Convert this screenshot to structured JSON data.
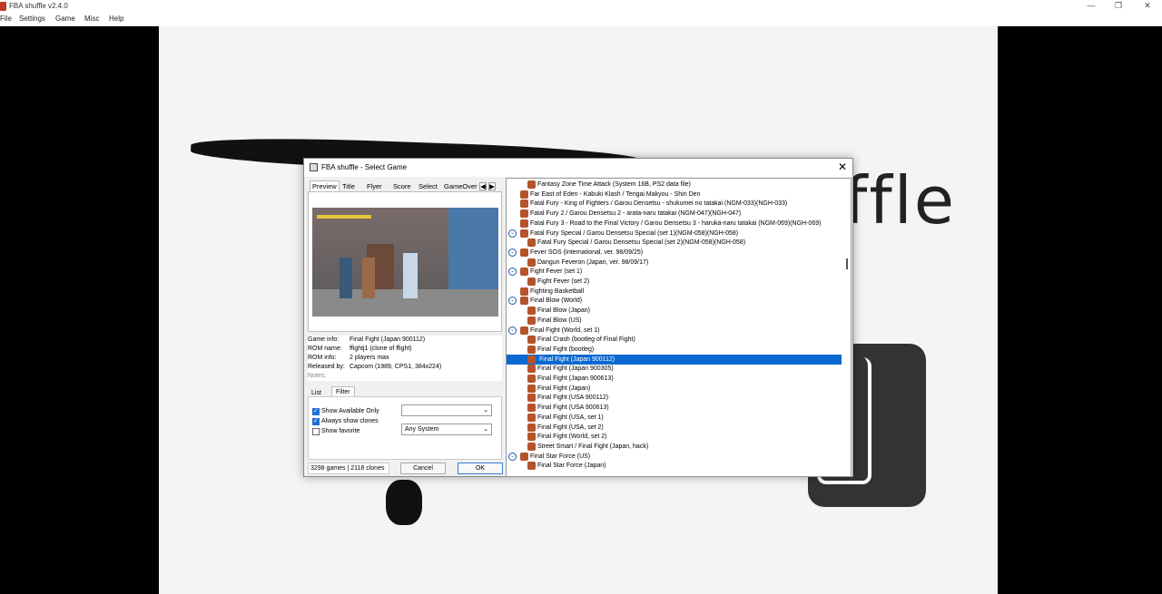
{
  "app": {
    "title": "FBA shuffle v2.4.0"
  },
  "window_controls": {
    "minimize": "—",
    "restore": "❐",
    "close": "✕"
  },
  "menu": [
    "File",
    "Settings",
    "Game",
    "Misc",
    "Help"
  ],
  "background": {
    "logo_text": "ffle"
  },
  "dialog": {
    "title": "FBA shuffle - Select Game",
    "close": "✕",
    "tabs": [
      "Preview",
      "Title",
      "Flyer",
      "Score",
      "Select",
      "GameOver"
    ],
    "tab_left": "◀",
    "tab_right": "▶",
    "info": {
      "game_info_label": "Game info:",
      "game_info_value": "Final Fight (Japan 900112)",
      "rom_name_label": "ROM name:",
      "rom_name_value": "ffightj1 (clone of ffight)",
      "rom_info_label": "ROM info:",
      "rom_info_value": "2 players max",
      "released_label": "Released by:",
      "released_value": "Capcom (1989, CPS1, 384x224)",
      "notes_label": "Notes:"
    },
    "filter_tabs": [
      "List",
      "Filter"
    ],
    "filter": {
      "show_available": "Show Available Only",
      "always_show_clones": "Always show clones",
      "show_favorite": "Show favorite",
      "combo1": "",
      "combo2": "Any System",
      "show_available_checked": true,
      "always_show_clones_checked": true,
      "show_favorite_checked": false
    },
    "count": "3298 games | 2118 clones",
    "cancel": "Cancel",
    "ok": "OK",
    "games": [
      {
        "label": "Fantasy Zone Time Attack (System 16B, PS2 data file)",
        "level": 2,
        "exp": false
      },
      {
        "label": "Far East of Eden - Kabuki Klash / Tengai Makyou - Shin Den",
        "level": 1,
        "exp": false
      },
      {
        "label": "Fatal Fury - King of Fighters / Garou Densetsu - shukumei no tatakai (NGM-033)(NGH-033)",
        "level": 1,
        "exp": false
      },
      {
        "label": "Fatal Fury 2 / Garou Densetsu 2 - arata-naru tatakai (NGM-047)(NGH-047)",
        "level": 1,
        "exp": false
      },
      {
        "label": "Fatal Fury 3 - Road to the Final Victory / Garou Densetsu 3 - haruka-naru tatakai (NGM-069)(NGH-069)",
        "level": 1,
        "exp": false
      },
      {
        "label": "Fatal Fury Special / Garou Densetsu Special (set 1)(NGM-058)(NGH-058)",
        "level": 1,
        "exp": true
      },
      {
        "label": "Fatal Fury Special / Garou Densetsu Special (set 2)(NGM-058)(NGH-058)",
        "level": 2,
        "exp": false
      },
      {
        "label": "Fever SOS (International, ver. 98/09/25)",
        "level": 1,
        "exp": true
      },
      {
        "label": "Dangun Feveron (Japan, ver. 98/09/17)",
        "level": 2,
        "exp": false
      },
      {
        "label": "Fight Fever (set 1)",
        "level": 1,
        "exp": true
      },
      {
        "label": "Fight Fever (set 2)",
        "level": 2,
        "exp": false
      },
      {
        "label": "Fighting Basketball",
        "level": 1,
        "exp": false
      },
      {
        "label": "Final Blow (World)",
        "level": 1,
        "exp": true
      },
      {
        "label": "Final Blow (Japan)",
        "level": 2,
        "exp": false
      },
      {
        "label": "Final Blow (US)",
        "level": 2,
        "exp": false
      },
      {
        "label": "Final Fight (World, set 1)",
        "level": 1,
        "exp": true
      },
      {
        "label": "Final Crash (bootleg of Final Fight)",
        "level": 2,
        "exp": false
      },
      {
        "label": "Final Fight (bootleg)",
        "level": 2,
        "exp": false
      },
      {
        "label": "Final Fight (Japan 900112)",
        "level": 2,
        "exp": false,
        "selected": true
      },
      {
        "label": "Final Fight (Japan 900305)",
        "level": 2,
        "exp": false
      },
      {
        "label": "Final Fight (Japan 900613)",
        "level": 2,
        "exp": false
      },
      {
        "label": "Final Fight (Japan)",
        "level": 2,
        "exp": false
      },
      {
        "label": "Final Fight (USA 900112)",
        "level": 2,
        "exp": false
      },
      {
        "label": "Final Fight (USA 900613)",
        "level": 2,
        "exp": false
      },
      {
        "label": "Final Fight (USA, set 1)",
        "level": 2,
        "exp": false
      },
      {
        "label": "Final Fight (USA, set 2)",
        "level": 2,
        "exp": false
      },
      {
        "label": "Final Fight (World, set 2)",
        "level": 2,
        "exp": false
      },
      {
        "label": "Street Smart / Final Fight (Japan, hack)",
        "level": 2,
        "exp": false
      },
      {
        "label": "Final Star Force (US)",
        "level": 1,
        "exp": true
      },
      {
        "label": "Final Star Force (Japan)",
        "level": 2,
        "exp": false
      }
    ]
  }
}
